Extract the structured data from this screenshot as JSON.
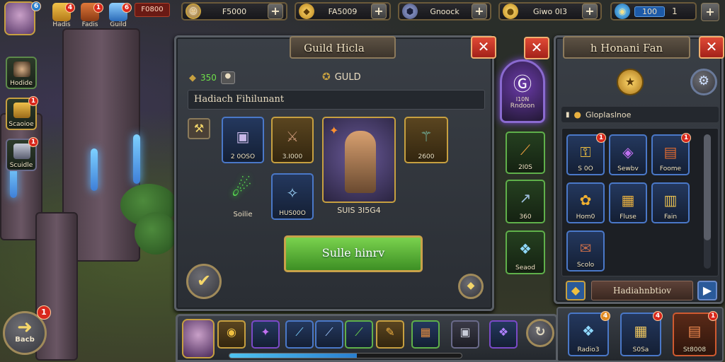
{
  "top_bar": {
    "player_level_badge": "6",
    "quest_icons": [
      {
        "label": "Hadis",
        "badge": "4"
      },
      {
        "label": "Fadis",
        "badge": "1"
      },
      {
        "label": "Guild",
        "badge": "6"
      }
    ],
    "red_counter": "F0800",
    "resources": [
      {
        "name": "hero-portrait",
        "value": "F5000"
      },
      {
        "name": "gold",
        "value": "FA5009"
      },
      {
        "name": "stone",
        "value": "Gnoock"
      },
      {
        "name": "coins",
        "value": "Giwo  0I3"
      },
      {
        "name": "gems",
        "value": "100",
        "suffix": "1"
      }
    ]
  },
  "left_sidebar": [
    {
      "label": "Hodide",
      "badge": ""
    },
    {
      "label": "Scaoioe",
      "badge": "1"
    },
    {
      "label": "Scuidle",
      "badge": "1"
    }
  ],
  "back_button": {
    "label": "Bacb",
    "badge": "1"
  },
  "guild_panel": {
    "title": "Guild Hicla",
    "close": "✕",
    "stat_value": "350",
    "guild_label": "GULD",
    "subtitle": "Hadiach Fihilunant",
    "items": [
      {
        "label": "2 0OSO",
        "color": "blue"
      },
      {
        "label": "3.I000",
        "color": "gold"
      },
      {
        "label": "2600",
        "color": "gold"
      },
      {
        "label": "Soilie",
        "color": "green"
      },
      {
        "label": "HUS00O",
        "color": "blue"
      }
    ],
    "hero_label": "SUIS 3I5G4",
    "confirm_button": "Sulle hinrv"
  },
  "emblem": {
    "label": "Rndoon",
    "sub": "I10N"
  },
  "mid_column": [
    {
      "label": "2I0S"
    },
    {
      "label": "360"
    },
    {
      "label": "Seaod"
    }
  ],
  "right_panel": {
    "title": "h Honani Fan",
    "close": "✕",
    "section": "Gloplaslnoe",
    "items": [
      {
        "label": "S 0O",
        "color": "blue",
        "badge": "1"
      },
      {
        "label": "Sewbv",
        "color": "blue",
        "badge": ""
      },
      {
        "label": "Foome",
        "color": "red",
        "badge": "1"
      },
      {
        "label": "Hom0",
        "color": "blue",
        "badge": ""
      },
      {
        "label": "Fluse",
        "color": "blue",
        "badge": ""
      },
      {
        "label": "Fain",
        "color": "blue",
        "badge": ""
      },
      {
        "label": "Scolo",
        "color": "blue",
        "badge": ""
      }
    ],
    "footer_label": "Hadiahnbtiov",
    "bottom_items": [
      {
        "label": "Radio3",
        "badge": "4"
      },
      {
        "label": "S0Sa",
        "badge": "4"
      },
      {
        "label": "St8008",
        "badge": "1"
      }
    ]
  },
  "hotbar": {
    "slots": [
      "",
      "",
      "",
      "",
      "",
      "",
      "",
      "",
      ""
    ],
    "xp_fraction": 0.55
  }
}
